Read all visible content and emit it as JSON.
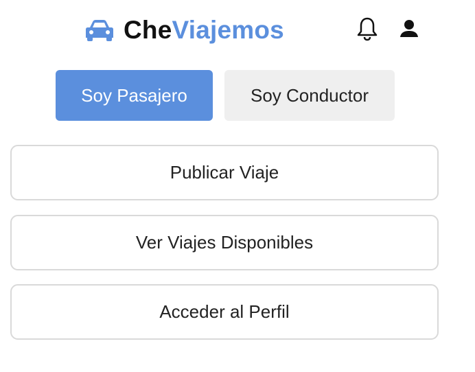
{
  "app": {
    "brand_part_1": "Che",
    "brand_part_2": "Viajemos",
    "brand_icon": "car-icon",
    "colors": {
      "accent": "#5b8fdd",
      "inactive_bg": "#efefef",
      "border": "#d9d9d9",
      "text": "#222222"
    }
  },
  "header": {
    "icons": [
      "bell-icon",
      "user-icon"
    ]
  },
  "role_toggle": {
    "selected": "Soy Pasajero",
    "options": [
      {
        "label": "Soy Pasajero"
      },
      {
        "label": "Soy Conductor"
      }
    ]
  },
  "actions": [
    {
      "label": "Publicar Viaje"
    },
    {
      "label": "Ver Viajes Disponibles"
    },
    {
      "label": "Acceder al Perfil"
    }
  ]
}
